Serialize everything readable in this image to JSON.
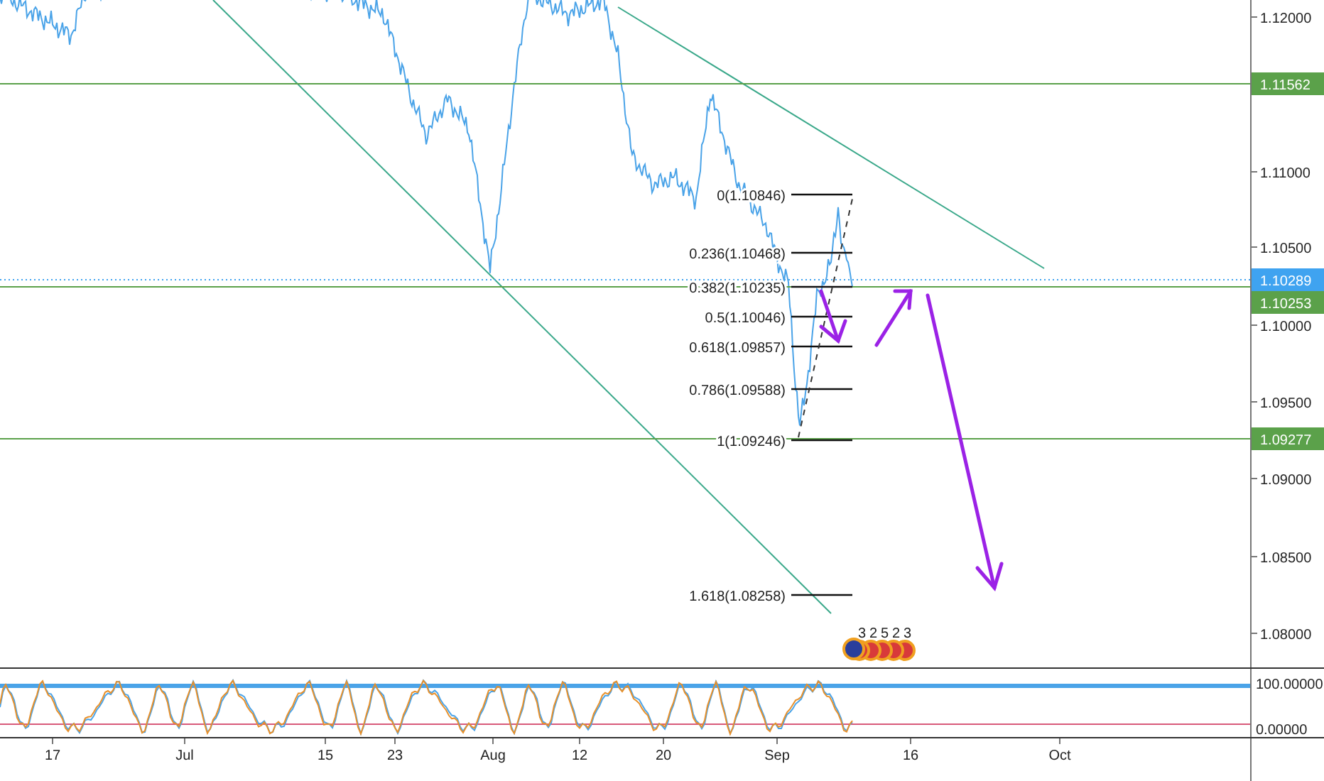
{
  "price_axis": {
    "ticks": [
      "1.12000",
      "1.11000",
      "1.10500",
      "1.10000",
      "1.09500",
      "1.09000",
      "1.08500",
      "1.08000"
    ]
  },
  "levels": [
    {
      "label": "1.11562",
      "color": "#5ba14a",
      "kind": "solid"
    },
    {
      "label": "1.10289",
      "color": "#3fa3f0",
      "kind": "dotted"
    },
    {
      "label": "1.10253",
      "color": "#5ba14a",
      "kind": "solid"
    },
    {
      "label": "1.09277",
      "color": "#5ba14a",
      "kind": "solid"
    }
  ],
  "fibonacci": {
    "levels": [
      "0(1.10846)",
      "0.236(1.10468)",
      "0.382(1.10235)",
      "0.5(1.10046)",
      "0.618(1.09857)",
      "0.786(1.09588)",
      "1(1.09246)",
      "1.618(1.08258)"
    ]
  },
  "events": {
    "counts": [
      "3",
      "2",
      "5",
      "2",
      "3"
    ]
  },
  "oscillator": {
    "ticks": [
      "100.00000",
      "0.00000"
    ]
  },
  "time_axis": {
    "labels": [
      "17",
      "Jul",
      "15",
      "23",
      "Aug",
      "12",
      "20",
      "Sep",
      "16",
      "Oct"
    ]
  }
}
